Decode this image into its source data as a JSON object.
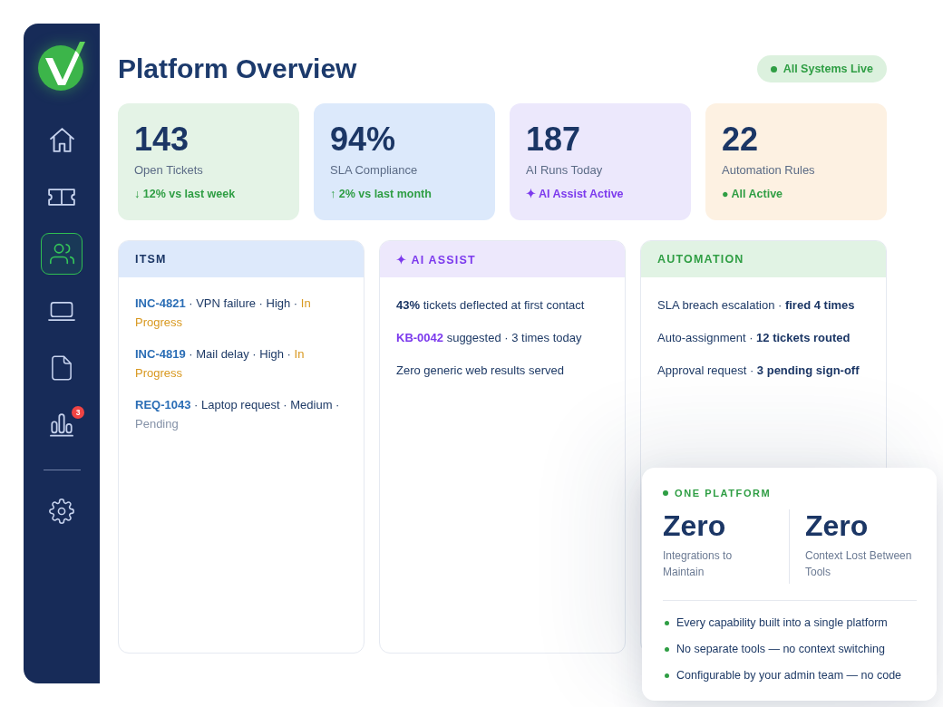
{
  "sidebar": {
    "items": [
      {
        "selected": false
      },
      {
        "selected": false
      },
      {
        "selected": true
      },
      {
        "selected": false
      },
      {
        "selected": false
      },
      {
        "selected": false,
        "badge": "3"
      }
    ],
    "footer_items": [
      {
        "selected": false
      }
    ]
  },
  "header": {
    "title": "Platform Overview",
    "status": "All Systems Live"
  },
  "stats": [
    {
      "value": "143",
      "label": "Open Tickets",
      "trend": {
        "text": "↓ 12% vs last week",
        "color": "#2f9e44"
      },
      "color": "#e4f3e6"
    },
    {
      "value": "94%",
      "label": "SLA Compliance",
      "trend": {
        "text": "↑ 2% vs last month",
        "color": "#2f9e44"
      },
      "color": "#dce9fb"
    },
    {
      "value": "187",
      "label": "AI Runs Today",
      "trend": {
        "text": "✦ AI Assist Active",
        "color": "#7c3aed"
      },
      "color": "#ece8fc"
    },
    {
      "value": "22",
      "label": "Automation Rules",
      "trend": {
        "text": "● All Active",
        "color": "#2f9e44"
      },
      "color": "#fdf1e2"
    }
  ],
  "panels": [
    {
      "kind": "tickets",
      "title": "ITSM",
      "items": [
        {
          "id": "INC-4821",
          "text": "· VPN failure · High ·",
          "status": "In Progress",
          "color": "#d8981f"
        },
        {
          "id": "INC-4819",
          "text": "· Mail delay · High ·",
          "status": "In Progress",
          "color": "#d8981f"
        },
        {
          "id": "REQ-1043",
          "text": "· Laptop request · Medium ·",
          "status": "Pending",
          "color": "#8592a8"
        }
      ]
    },
    {
      "kind": "assist",
      "title": "✦ AI ASSIST",
      "items": [
        {
          "lead": "43%",
          "text": "tickets deflected at first contact",
          "color": "#1b3665"
        },
        {
          "lead": "KB-0042",
          "text": "suggested · 3 times today",
          "color": "#7c3aed"
        },
        {
          "text": "Zero generic web results served"
        }
      ]
    },
    {
      "kind": "rules",
      "title": "AUTOMATION",
      "items": [
        {
          "text": "SLA breach escalation · **fired 4 times**"
        },
        {
          "text": "Auto-assignment · **12 tickets routed**"
        },
        {
          "text": "Approval request · **3 pending sign-off**"
        }
      ]
    }
  ],
  "highlight": {
    "eyebrow": "ONE PLATFORM",
    "metrics": [
      {
        "value": "Zero",
        "label": "Integrations to Maintain"
      },
      {
        "value": "Zero",
        "label": "Context Lost Between Tools"
      }
    ],
    "points": [
      "Every capability built into a single platform",
      "No separate tools — no context switching",
      "Configurable by your admin team — no code"
    ]
  }
}
